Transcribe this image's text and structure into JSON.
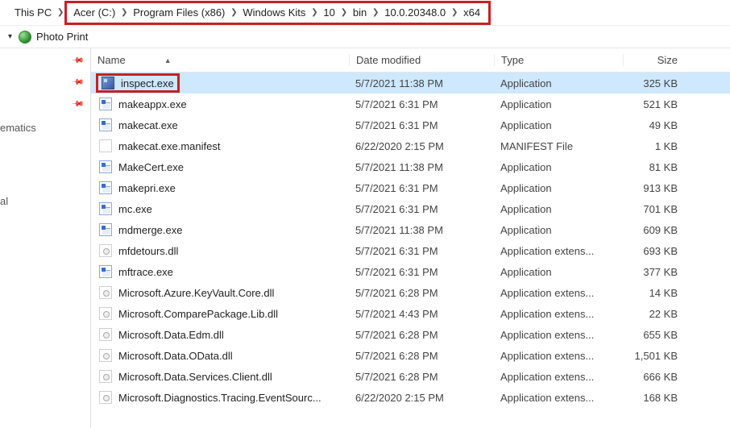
{
  "breadcrumb": {
    "root": "This PC",
    "items": [
      "Acer (C:)",
      "Program Files (x86)",
      "Windows Kits",
      "10",
      "bin",
      "10.0.20348.0",
      "x64"
    ]
  },
  "toolbar": {
    "photo_print": "Photo Print"
  },
  "nav": {
    "items": [
      {
        "label": "",
        "pin": true
      },
      {
        "label": "",
        "pin": true
      },
      {
        "label": "",
        "pin": true
      },
      {
        "label": "ematics",
        "pin": false
      },
      {
        "label": "",
        "pin": false
      },
      {
        "label": "al",
        "pin": false
      }
    ]
  },
  "columns": {
    "name": "Name",
    "date": "Date modified",
    "type": "Type",
    "size": "Size"
  },
  "files": [
    {
      "icon": "inspect",
      "name": "inspect.exe",
      "date": "5/7/2021 11:38 PM",
      "type": "Application",
      "size": "325 KB",
      "selected": true,
      "highlight": true
    },
    {
      "icon": "exe",
      "name": "makeappx.exe",
      "date": "5/7/2021 6:31 PM",
      "type": "Application",
      "size": "521 KB"
    },
    {
      "icon": "exe",
      "name": "makecat.exe",
      "date": "5/7/2021 6:31 PM",
      "type": "Application",
      "size": "49 KB"
    },
    {
      "icon": "file",
      "name": "makecat.exe.manifest",
      "date": "6/22/2020 2:15 PM",
      "type": "MANIFEST File",
      "size": "1 KB"
    },
    {
      "icon": "exe",
      "name": "MakeCert.exe",
      "date": "5/7/2021 11:38 PM",
      "type": "Application",
      "size": "81 KB"
    },
    {
      "icon": "exe",
      "name": "makepri.exe",
      "date": "5/7/2021 6:31 PM",
      "type": "Application",
      "size": "913 KB"
    },
    {
      "icon": "exe",
      "name": "mc.exe",
      "date": "5/7/2021 6:31 PM",
      "type": "Application",
      "size": "701 KB"
    },
    {
      "icon": "exe",
      "name": "mdmerge.exe",
      "date": "5/7/2021 11:38 PM",
      "type": "Application",
      "size": "609 KB"
    },
    {
      "icon": "dll",
      "name": "mfdetours.dll",
      "date": "5/7/2021 6:31 PM",
      "type": "Application extens...",
      "size": "693 KB"
    },
    {
      "icon": "exe",
      "name": "mftrace.exe",
      "date": "5/7/2021 6:31 PM",
      "type": "Application",
      "size": "377 KB"
    },
    {
      "icon": "dll",
      "name": "Microsoft.Azure.KeyVault.Core.dll",
      "date": "5/7/2021 6:28 PM",
      "type": "Application extens...",
      "size": "14 KB"
    },
    {
      "icon": "dll",
      "name": "Microsoft.ComparePackage.Lib.dll",
      "date": "5/7/2021 4:43 PM",
      "type": "Application extens...",
      "size": "22 KB"
    },
    {
      "icon": "dll",
      "name": "Microsoft.Data.Edm.dll",
      "date": "5/7/2021 6:28 PM",
      "type": "Application extens...",
      "size": "655 KB"
    },
    {
      "icon": "dll",
      "name": "Microsoft.Data.OData.dll",
      "date": "5/7/2021 6:28 PM",
      "type": "Application extens...",
      "size": "1,501 KB"
    },
    {
      "icon": "dll",
      "name": "Microsoft.Data.Services.Client.dll",
      "date": "5/7/2021 6:28 PM",
      "type": "Application extens...",
      "size": "666 KB"
    },
    {
      "icon": "dll",
      "name": "Microsoft.Diagnostics.Tracing.EventSourc...",
      "date": "6/22/2020 2:15 PM",
      "type": "Application extens...",
      "size": "168 KB"
    }
  ]
}
